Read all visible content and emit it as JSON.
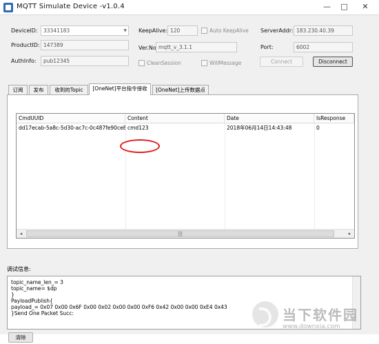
{
  "window": {
    "title": "MQTT Simulate Device  -v1.0.4",
    "minimize": "—",
    "maximize": "□",
    "close": "✕"
  },
  "connection": {
    "device_id_label": "DeviceID:",
    "device_id_value": "33341183",
    "product_id_label": "ProductID:",
    "product_id_value": "147389",
    "auth_info_label": "AuthInfo:",
    "auth_info_value": "pub12345",
    "keepalive_label": "KeepAlive:",
    "keepalive_value": "120",
    "auto_keepalive_label": "Auto KeepAlive",
    "ver_no_label": "Ver.No",
    "ver_no_value": "mqtt_v_3.1.1",
    "clean_session_label": "CleanSession",
    "will_message_label": "WillMessage",
    "server_addr_label": "ServerAddr:",
    "server_addr_value": "183.230.40.39",
    "port_label": "Port:",
    "port_value": "6002",
    "connect_label": "Connect",
    "disconnect_label": "Disconnect"
  },
  "tabs": [
    {
      "label": "订阅"
    },
    {
      "label": "发布"
    },
    {
      "label": "收到的Topic"
    },
    {
      "label": "[OneNet]平台指令接收"
    },
    {
      "label": "[OneNet]上传数据点"
    }
  ],
  "command_table": {
    "columns": [
      "CmdUUID",
      "Content",
      "Date",
      "IsResponse"
    ],
    "rows": [
      {
        "uuid": "dd17ecab-5a8c-5d30-ac7c-0c487fe90ce8",
        "content": "cmd123",
        "date": "2018年06月14日14:43:48",
        "is_response": "0"
      }
    ],
    "scroll_left": "◂",
    "scroll_thumb": "|||",
    "scroll_right": "▸"
  },
  "debug": {
    "label": "调试信息:",
    "lines": [
      "topic_name_len_= 3",
      "topic_name= $dp",
      "}",
      "PayloadPublish{",
      "payload_= 0x07 0x00 0x6F 0x00 0x02 0x00 0x00 0xF6 0x42 0x00 0x00 0xE4 0x43",
      "}Send One Packet Succ:"
    ],
    "clear_label": "清除"
  },
  "watermark": {
    "name": "当下软件园",
    "url": "www.downxia.com"
  },
  "colors": {
    "highlight": "#e01e1e",
    "panel_bg": "#f0f0f0"
  }
}
